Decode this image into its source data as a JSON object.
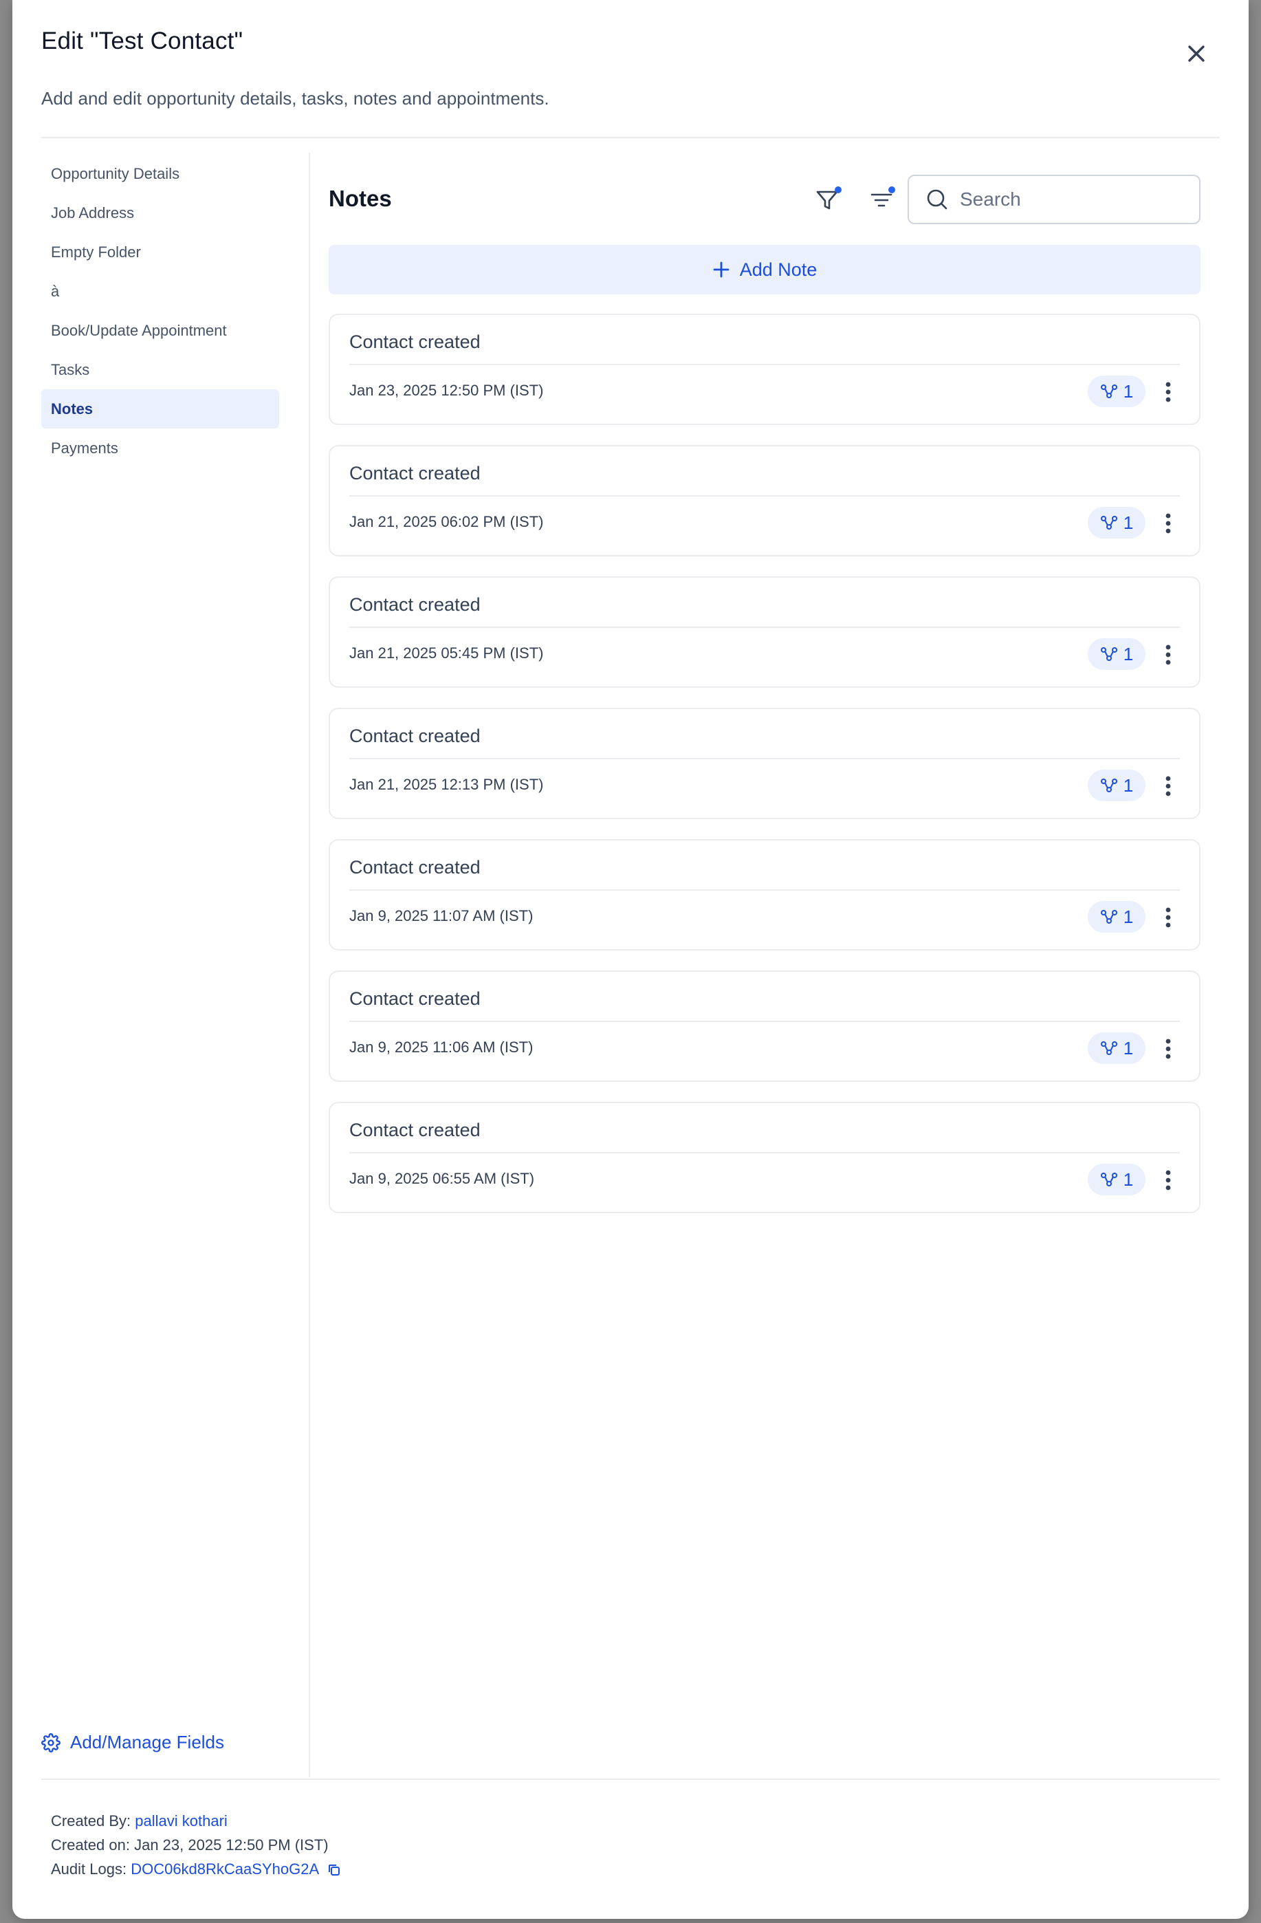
{
  "modal": {
    "title": "Edit \"Test Contact\"",
    "subtitle": "Add and edit opportunity details, tasks, notes and appointments."
  },
  "sidebar": {
    "items": [
      {
        "label": "Opportunity Details"
      },
      {
        "label": "Job Address"
      },
      {
        "label": "Empty Folder"
      },
      {
        "label": "à"
      },
      {
        "label": "Book/Update Appointment"
      },
      {
        "label": "Tasks"
      },
      {
        "label": "Notes",
        "active": true
      },
      {
        "label": "Payments"
      }
    ],
    "manage_fields_label": "Add/Manage Fields"
  },
  "notes": {
    "title": "Notes",
    "search_placeholder": "Search",
    "add_note_label": "Add Note",
    "items": [
      {
        "text": "Contact created",
        "date": "Jan 23, 2025 12:50 PM (IST)",
        "assoc_count": "1"
      },
      {
        "text": "Contact created",
        "date": "Jan 21, 2025 06:02 PM (IST)",
        "assoc_count": "1"
      },
      {
        "text": "Contact created",
        "date": "Jan 21, 2025 05:45 PM (IST)",
        "assoc_count": "1"
      },
      {
        "text": "Contact created",
        "date": "Jan 21, 2025 12:13 PM (IST)",
        "assoc_count": "1"
      },
      {
        "text": "Contact created",
        "date": "Jan 9, 2025 11:07 AM (IST)",
        "assoc_count": "1"
      },
      {
        "text": "Contact created",
        "date": "Jan 9, 2025 11:06 AM (IST)",
        "assoc_count": "1"
      },
      {
        "text": "Contact created",
        "date": "Jan 9, 2025 06:55 AM (IST)",
        "assoc_count": "1"
      }
    ]
  },
  "footer": {
    "created_by_label": "Created By:",
    "created_by_value": "pallavi kothari",
    "created_on_label": "Created on:",
    "created_on_value": "Jan 23, 2025 12:50 PM (IST)",
    "audit_logs_label": "Audit Logs:",
    "audit_logs_value": "DOC06kd8RkCaaSYhoG2A"
  },
  "colors": {
    "accent": "#1d4ed8",
    "active_bg": "#eaf0fc",
    "indicator_dot": "#2563eb"
  },
  "icons": [
    "close-icon",
    "filter-icon",
    "sort-icon",
    "search-icon",
    "plus-icon",
    "gear-icon",
    "branch-icon",
    "more-vertical-icon",
    "copy-icon"
  ]
}
